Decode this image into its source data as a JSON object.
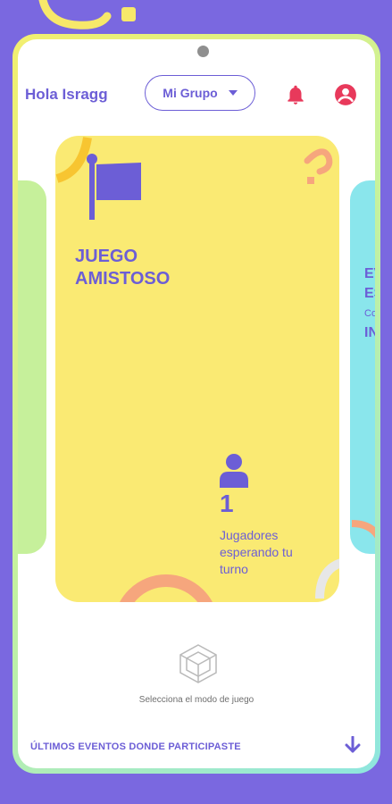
{
  "header": {
    "greeting": "Hola Isragg",
    "group_select_value": "Mi Grupo"
  },
  "main_card": {
    "title": "JUEGO AMISTOSO",
    "count": "1",
    "players_label": "Jugadores esperando tu turno"
  },
  "right_card": {
    "line1": "EV",
    "line2": "ES",
    "line3": "Co",
    "line4": "IN"
  },
  "mode_hint": "Selecciona el modo de juego",
  "events_title": "ÚLTIMOS EVENTOS DONDE PARTICIPASTE",
  "icons": {
    "group_select": "chevron-down-icon",
    "bell": "bell-icon",
    "account": "account-icon",
    "flag": "flag-icon",
    "person": "person-icon",
    "mode": "cube-icon",
    "arrow": "arrow-down-icon"
  },
  "colors": {
    "background": "#7a68e0",
    "accent": "#6c5ed6",
    "main_card": "#faea73",
    "left_card": "#c6f09b",
    "right_card": "#8ae6ec",
    "alert_icon": "#e8395b"
  }
}
